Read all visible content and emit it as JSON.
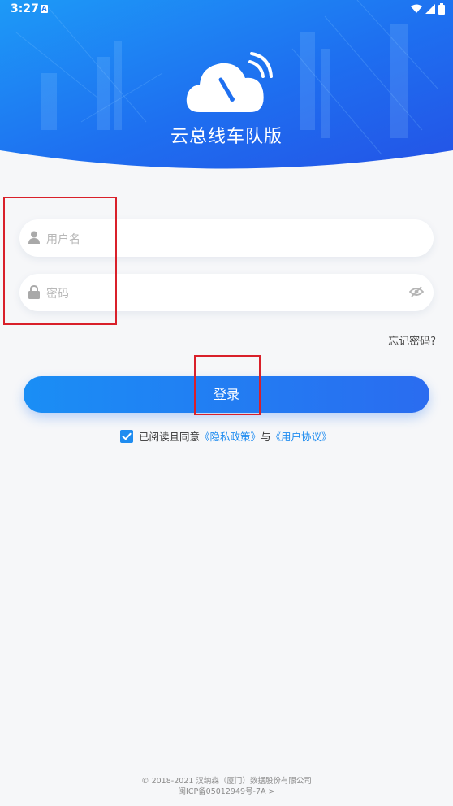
{
  "status_bar": {
    "time": "3:27",
    "notification_badge": "A",
    "icons": [
      "wifi-icon",
      "signal-icon",
      "battery-icon"
    ]
  },
  "app": {
    "title": "云总线车队版",
    "logo_icon": "cloud-speedometer-wifi-icon"
  },
  "form": {
    "username_placeholder": "用户名",
    "password_placeholder": "密码",
    "username_icon": "user-icon",
    "password_icon": "lock-icon",
    "password_toggle_icon": "eye-hidden-icon",
    "forgot_label": "忘记密码?",
    "login_label": "登录"
  },
  "agreement": {
    "checked": true,
    "prefix": "已阅读且同意",
    "privacy_link": "《隐私政策》",
    "connector": "与",
    "user_link": "《用户协议》"
  },
  "footer": {
    "copyright": "© 2018-2021 汉纳森（厦门）数据股份有限公司",
    "icp": "闽ICP备05012949号-7A >"
  },
  "colors": {
    "header_start": "#1a8ef5",
    "header_end": "#2356e8",
    "primary": "#1f8cf0",
    "highlight_box": "#d9202a"
  }
}
